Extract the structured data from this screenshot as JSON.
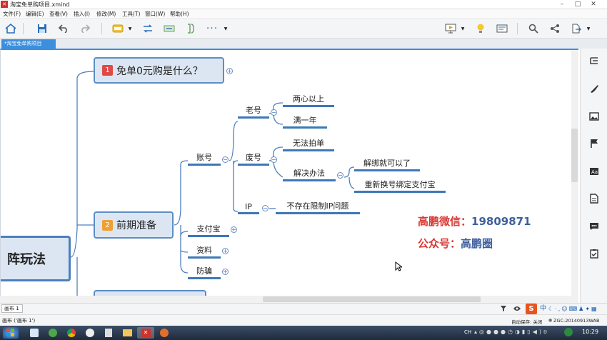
{
  "window": {
    "title": "淘宝免单购项目.xmind"
  },
  "menu": [
    "文件(F)",
    "编辑(E)",
    "查看(V)",
    "插入(I)",
    "修改(M)",
    "工具(T)",
    "窗口(W)",
    "帮助(H)"
  ],
  "tab": {
    "label": "*淘宝免单购项目"
  },
  "mindmap": {
    "root": "阵玩法",
    "topic1": {
      "num": "1",
      "label": "免单0元购是什么？",
      "color": "#e04a46"
    },
    "topic2": {
      "num": "2",
      "label": "前期准备",
      "color": "#f0a030"
    },
    "account": "账号",
    "old_account": "老号",
    "two_hearts": "两心以上",
    "one_year": "满一年",
    "waste_account": "废号",
    "cannot_order": "无法拍单",
    "solution": "解决办法",
    "unbind": "解绑就可以了",
    "rebind": "重新换号绑定支付宝",
    "ip": "IP",
    "no_ip_limit": "不存在限制IP问题",
    "alipay": "支付宝",
    "materials": "资料",
    "anti_fraud": "防骗"
  },
  "watermark": {
    "wechat_label": "高鹏微信：",
    "wechat_value": "19809871",
    "account_label": "公众号：",
    "account_value": "高鹏圈"
  },
  "sheet": {
    "tab": "画布 1"
  },
  "status": {
    "left": "画布 ('画布 1')",
    "autosave": "自动保存: 关闭",
    "machine": "ZGC-20140913WAB"
  },
  "ime": {
    "label": "中"
  },
  "taskbar": {
    "time": "10:29",
    "lang": "CH"
  }
}
